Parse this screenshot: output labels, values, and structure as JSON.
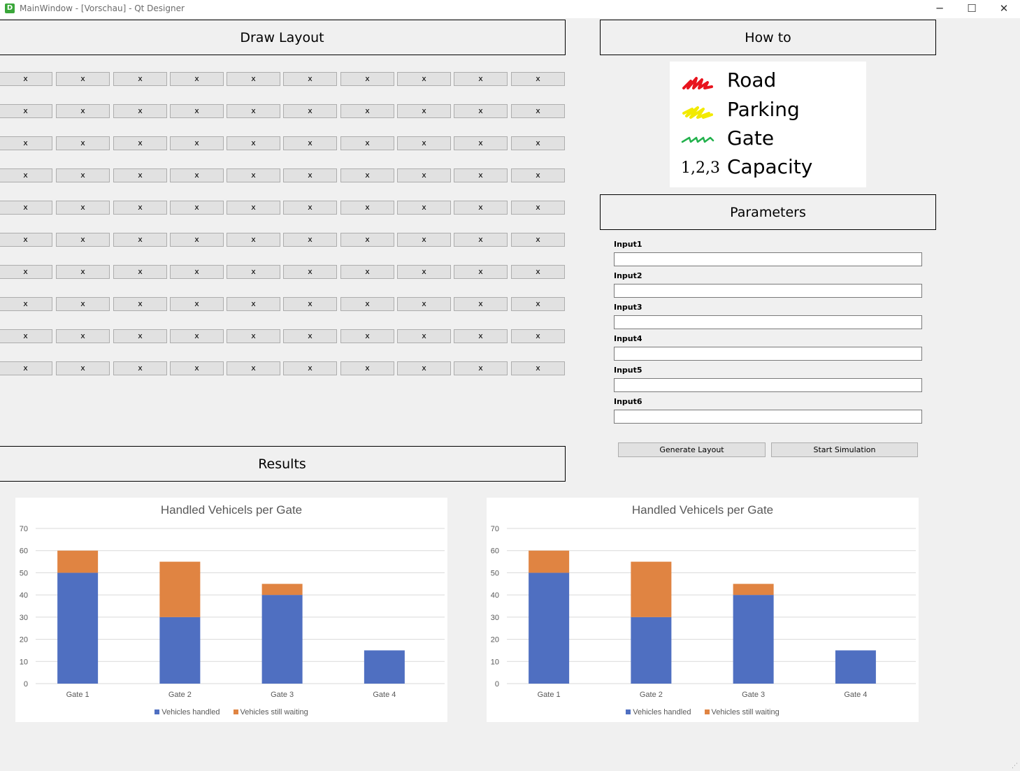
{
  "window": {
    "title": "MainWindow - [Vorschau] - Qt Designer",
    "icon_letter": "D",
    "minimize_glyph": "─",
    "maximize_glyph": "☐",
    "close_glyph": "✕"
  },
  "layout_section": {
    "title": "Draw Layout",
    "cell_label": "x",
    "rows": 10,
    "cols": 10
  },
  "howto": {
    "title": "How to",
    "legend": [
      {
        "label": "Road",
        "icon": "red-scribble-icon",
        "color": "#e8141e"
      },
      {
        "label": "Parking",
        "icon": "yellow-scribble-icon",
        "color": "#f2ea00"
      },
      {
        "label": "Gate",
        "icon": "green-scribble-icon",
        "color": "#22b14c"
      },
      {
        "label": "Capacity",
        "icon": "number-123-icon",
        "symbol": "1,2,3"
      }
    ]
  },
  "parameters": {
    "title": "Parameters",
    "inputs": [
      {
        "label": "Input1",
        "value": ""
      },
      {
        "label": "Input2",
        "value": ""
      },
      {
        "label": "Input3",
        "value": ""
      },
      {
        "label": "Input4",
        "value": ""
      },
      {
        "label": "Input5",
        "value": ""
      },
      {
        "label": "Input6",
        "value": ""
      }
    ]
  },
  "actions": {
    "generate_label": "Generate Layout",
    "start_label": "Start Simulation"
  },
  "results": {
    "title": "Results"
  },
  "chart_data": [
    {
      "type": "bar",
      "stacked": true,
      "title": "Handled Vehicels per Gate",
      "categories": [
        "Gate 1",
        "Gate 2",
        "Gate 3",
        "Gate 4"
      ],
      "series": [
        {
          "name": "Vehicles handled",
          "values": [
            50,
            30,
            40,
            15
          ],
          "color": "#4f6fc1"
        },
        {
          "name": "Vehicles still waiting",
          "values": [
            10,
            25,
            5,
            0
          ],
          "color": "#e08442"
        }
      ],
      "ylim": [
        0,
        70
      ],
      "yticks": [
        0,
        10,
        20,
        30,
        40,
        50,
        60,
        70
      ],
      "grid": true,
      "legend": "bottom"
    },
    {
      "type": "bar",
      "stacked": true,
      "title": "Handled Vehicels per Gate",
      "categories": [
        "Gate 1",
        "Gate 2",
        "Gate 3",
        "Gate 4"
      ],
      "series": [
        {
          "name": "Vehicles handled",
          "values": [
            50,
            30,
            40,
            15
          ],
          "color": "#4f6fc1"
        },
        {
          "name": "Vehicles still waiting",
          "values": [
            10,
            25,
            5,
            0
          ],
          "color": "#e08442"
        }
      ],
      "ylim": [
        0,
        70
      ],
      "yticks": [
        0,
        10,
        20,
        30,
        40,
        50,
        60,
        70
      ],
      "grid": true,
      "legend": "bottom"
    }
  ]
}
